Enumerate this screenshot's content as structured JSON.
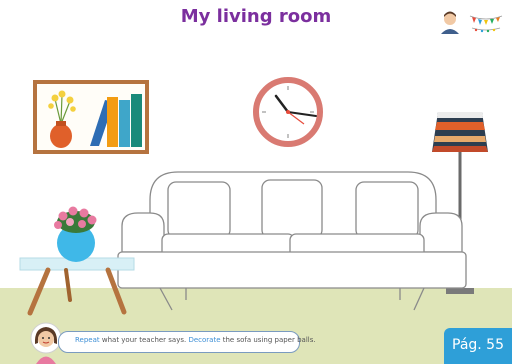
{
  "title": "My living room",
  "instructions": {
    "verb1": "Repeat",
    "text1": " what your teacher says. ",
    "verb2": "Decorate",
    "text2": " the sofa using paper balls."
  },
  "page_label": "Pág. 55",
  "colors": {
    "title": "#7b2f9e",
    "floor": "#dfe5b8",
    "page_tab": "#2e9fd8",
    "sofa_outline": "#8a8a8a"
  },
  "icons": [
    "teacher-icon",
    "bunting-icon",
    "student-avatar-icon"
  ],
  "scene": [
    "bookshelf",
    "vase-with-flowers",
    "books",
    "clock",
    "floor-lamp",
    "sofa",
    "coffee-table",
    "flower-pot"
  ]
}
